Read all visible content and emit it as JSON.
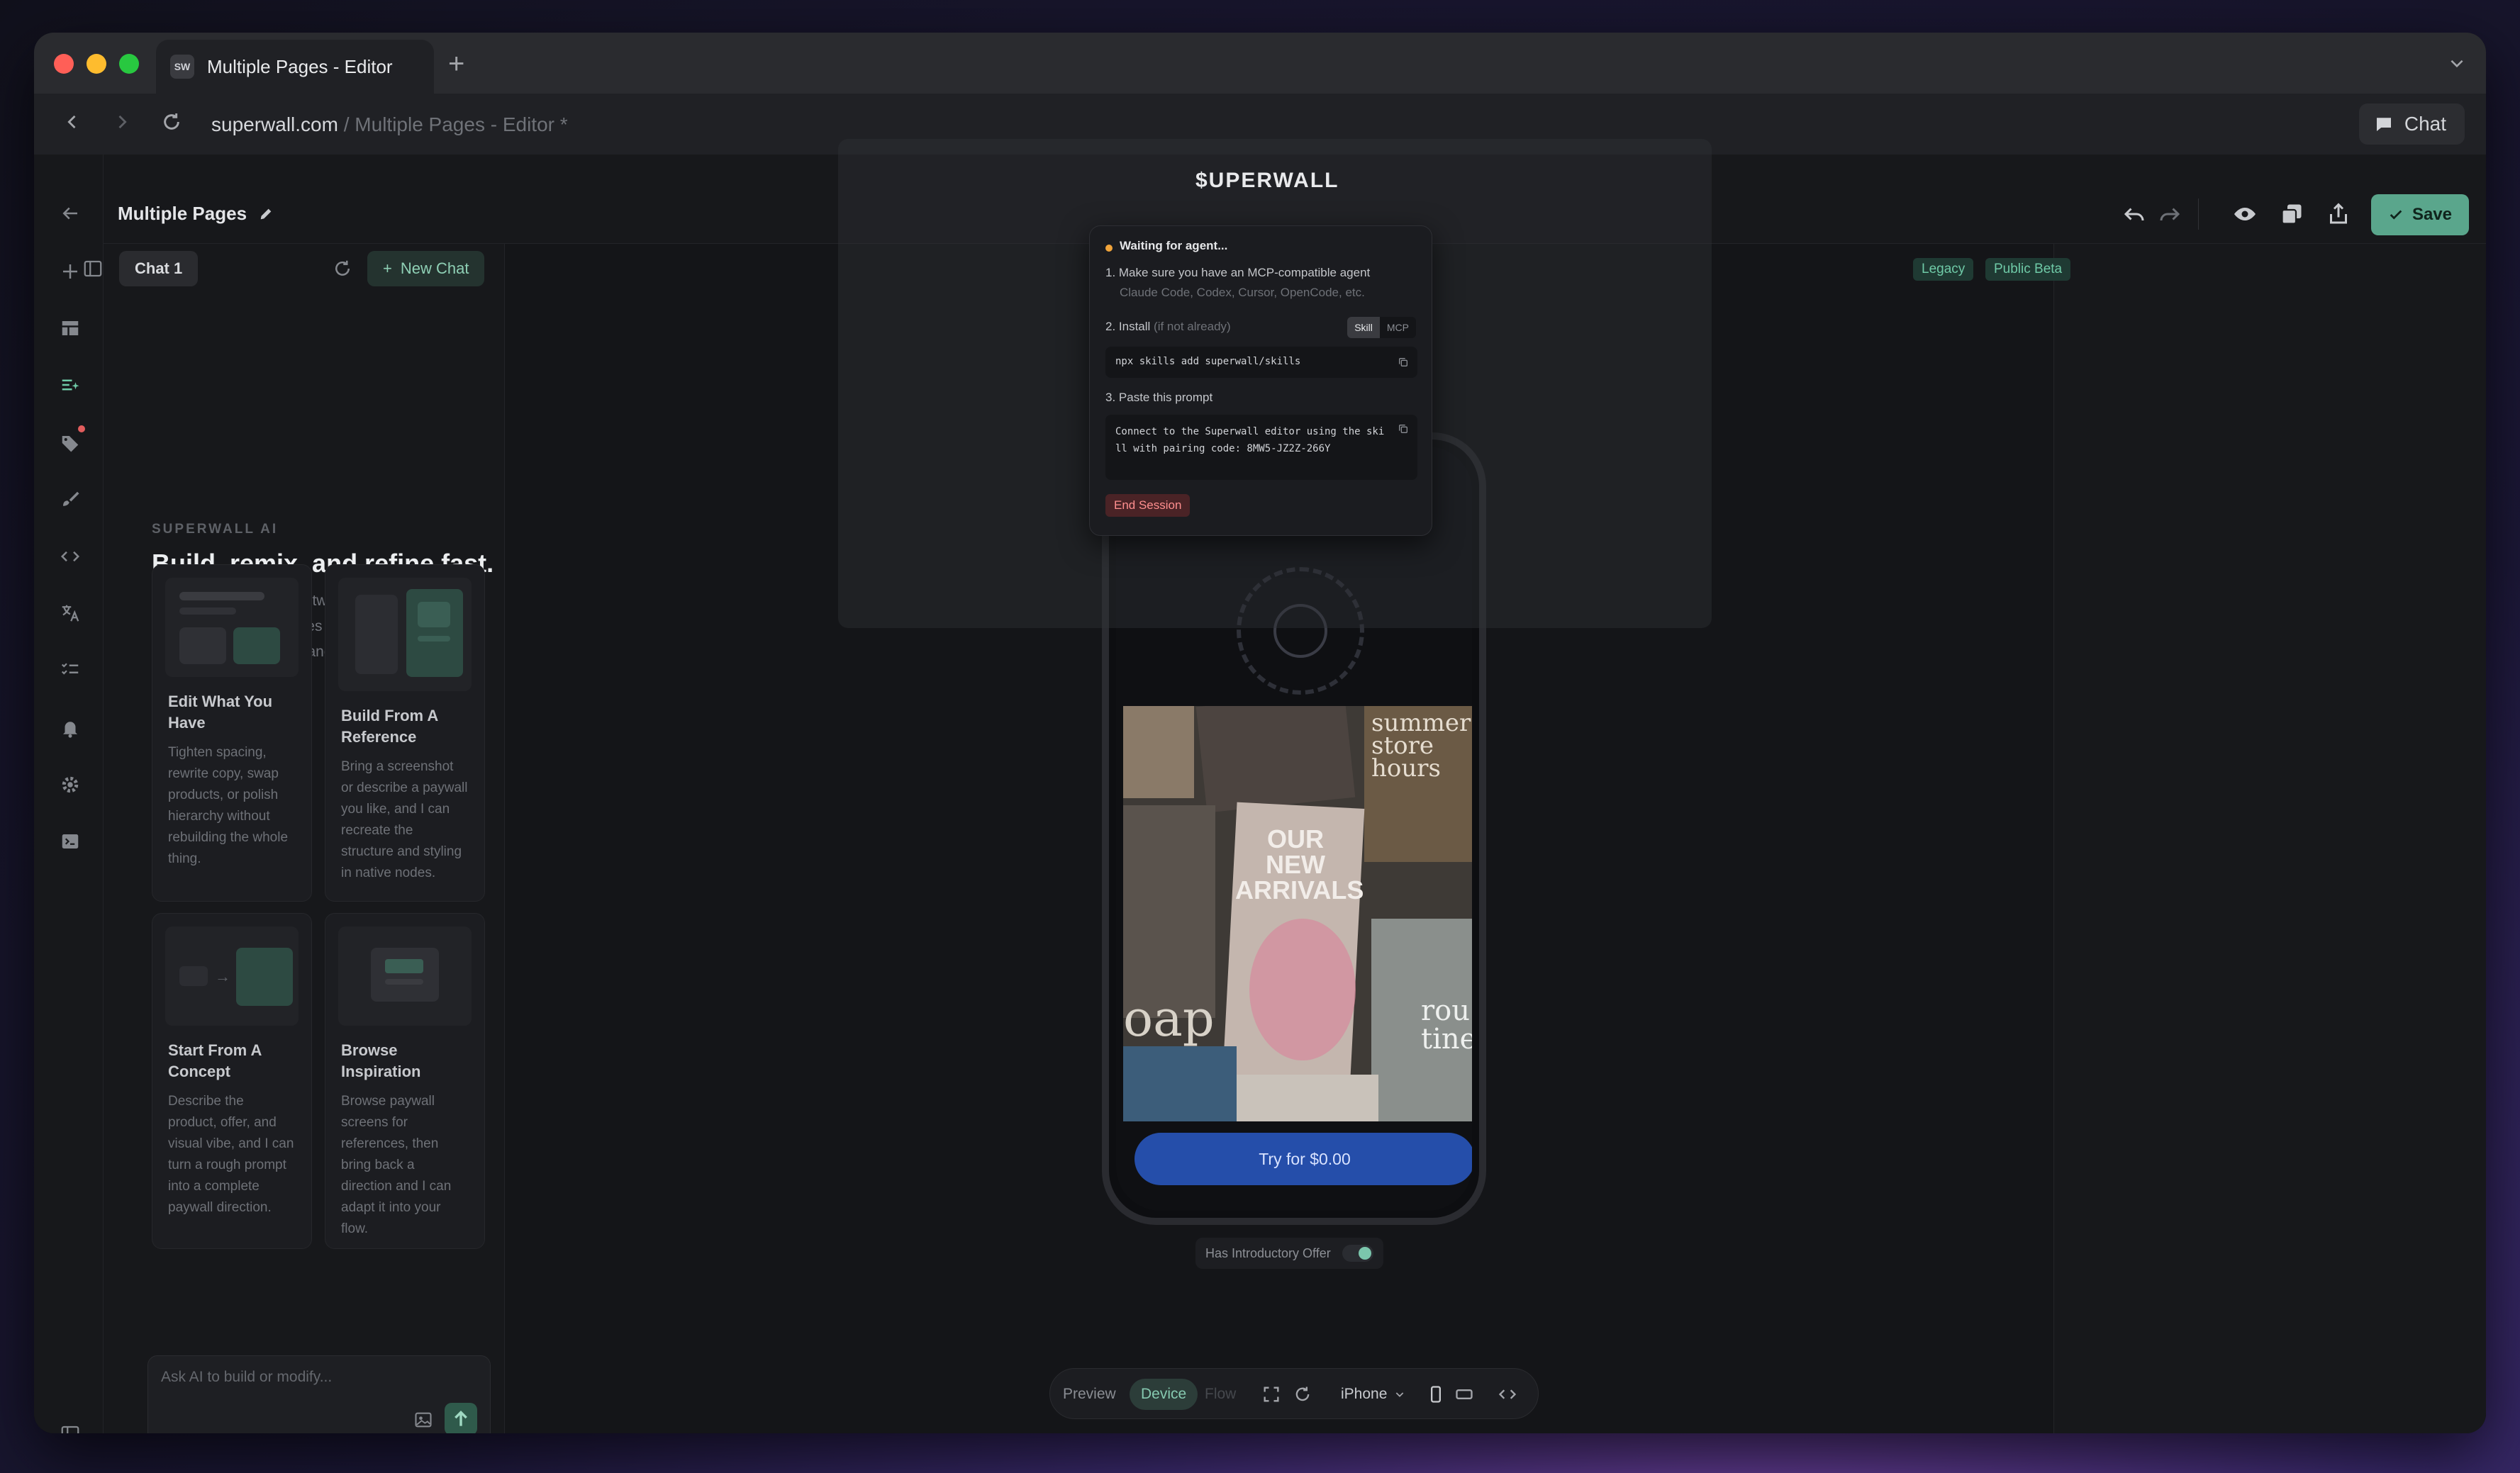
{
  "browser": {
    "tab_title": "Multiple Pages - Editor",
    "favicon_text": "SW",
    "new_tab": "+",
    "url_host": "superwall.com",
    "url_path": " / Multiple Pages - Editor *",
    "chat_button": "Chat"
  },
  "editor": {
    "project_title": "Multiple Pages",
    "save_label": "Save",
    "badges": [
      "Legacy",
      "Public Beta"
    ]
  },
  "chat_panel": {
    "tab_label": "Chat 1",
    "new_chat_label": "New Chat",
    "eyebrow": "SUPERWALL AI",
    "title": "Build, remix, and refine fast.",
    "description": "Start from a rough idea, tweak what is already on canvas, or pull references into production-ready paywalls, onboardings, and web flows.",
    "cards": [
      {
        "title": "Edit What You Have",
        "desc": "Tighten spacing, rewrite copy, swap products, or polish hierarchy without rebuilding the whole thing."
      },
      {
        "title": "Build From A Reference",
        "desc": "Bring a screenshot or describe a paywall you like, and I can recreate the structure and styling in native nodes."
      },
      {
        "title": "Start From A Concept",
        "desc": "Describe the product, offer, and visual vibe, and I can turn a rough prompt into a complete paywall direction."
      },
      {
        "title": "Browse Inspiration",
        "desc": "Browse paywall screens for references, then bring back a direction and I can adapt it into your flow."
      }
    ],
    "input_placeholder": "Ask AI to build or modify..."
  },
  "agent_dialog": {
    "brand": "$UPERWALL",
    "status": "Waiting for agent...",
    "step1": "1. Make sure you have an MCP-compatible agent",
    "step1_sub": "Claude Code, Codex, Cursor, OpenCode, etc.",
    "step2": "2. Install",
    "step2_note": "(if not already)",
    "segment_skill": "Skill",
    "segment_mcp": "MCP",
    "install_cmd": "npx skills add superwall/skills",
    "step3": "3. Paste this prompt",
    "prompt_text": "Connect to the Superwall editor using the skill with pairing code: 8MW5-JZ2Z-266Y",
    "end_session": "End Session"
  },
  "phone": {
    "cta": "Try for $0.00",
    "collage_text_1": "OUR NEW ARRIVALS",
    "collage_text_2": "summer store hours",
    "collage_text_3": "oap",
    "collage_text_4": "rou tine"
  },
  "canvas": {
    "intro_offer_label": "Has Introductory Offer",
    "intro_offer_on": true,
    "preview_tab": "Preview",
    "device_tab": "Device",
    "flow_tab": "Flow",
    "device_select": "iPhone"
  },
  "colors": {
    "accent": "#5aa68c",
    "cta_blue": "#254eaa",
    "danger": "#ff8f8f"
  }
}
